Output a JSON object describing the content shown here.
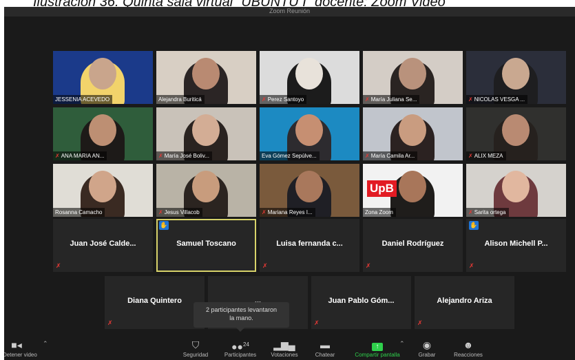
{
  "caption": "Ilustración 36. Quinta sala virtual “UBUNTU I” docente: Zoom Video",
  "window": {
    "title": "Zoom Reunión"
  },
  "video_tiles": [
    {
      "name": "JESSENIA ACEVEDO",
      "muted": false
    },
    {
      "name": "Alejandra Buriticá",
      "muted": false
    },
    {
      "name": "Perez Santoyo",
      "muted": true
    },
    {
      "name": "María Juliana Se...",
      "muted": true
    },
    {
      "name": "NICOLAS VESGA ...",
      "muted": true
    },
    {
      "name": "ANA MARIA AN...",
      "muted": true
    },
    {
      "name": "María José Boliv...",
      "muted": true
    },
    {
      "name": "Eva Gómez Sepúlve...",
      "muted": false
    },
    {
      "name": "María Camila Ar...",
      "muted": true
    },
    {
      "name": "ALIX MEZA",
      "muted": true
    },
    {
      "name": "Rosanna Camacho",
      "muted": false
    },
    {
      "name": "Jesus Villacob",
      "muted": true
    },
    {
      "name": "Mariana Reyes I...",
      "muted": true
    },
    {
      "name": "Zona Zoom",
      "muted": false
    },
    {
      "name": "Sarita ortega",
      "muted": true
    }
  ],
  "upb_logo": "UpB",
  "name_tiles_row1": [
    {
      "name": "Juan José Calde...",
      "muted": true,
      "hand": false
    },
    {
      "name": "Samuel Toscano",
      "muted": false,
      "hand": true
    },
    {
      "name": "Luisa fernanda c...",
      "muted": true,
      "hand": false
    },
    {
      "name": "Daniel Rodríguez",
      "muted": true,
      "hand": false
    },
    {
      "name": "Alison Michell P...",
      "muted": true,
      "hand": true
    }
  ],
  "name_tiles_row2": [
    {
      "name": "Diana Quintero",
      "muted": true
    },
    {
      "name": "...",
      "muted": false
    },
    {
      "name": "Juan Pablo Góm...",
      "muted": true
    },
    {
      "name": "Alejandro Ariza",
      "muted": true
    }
  ],
  "tooltip": {
    "line1": "2 participantes levantaron",
    "line2": "la mano."
  },
  "toolbar": {
    "stop_video": "Detener video",
    "security": "Seguridad",
    "participants": "Participantes",
    "participant_count": "24",
    "polls": "Votaciones",
    "chat": "Chatear",
    "share": "Compartir pantalla",
    "record": "Grabar",
    "reactions": "Reacciones"
  },
  "icons": [
    "video-camera-icon",
    "shield-icon",
    "participants-icon",
    "polls-icon",
    "chat-icon",
    "share-screen-icon",
    "record-icon",
    "reactions-icon",
    "raised-hand-icon",
    "muted-mic-icon"
  ],
  "colors": {
    "background": "#1a1a1a",
    "tile": "#262626",
    "hand": "#1e74d6",
    "mute": "#e53935",
    "share": "#2fd04c",
    "selected": "#d8d36a"
  }
}
